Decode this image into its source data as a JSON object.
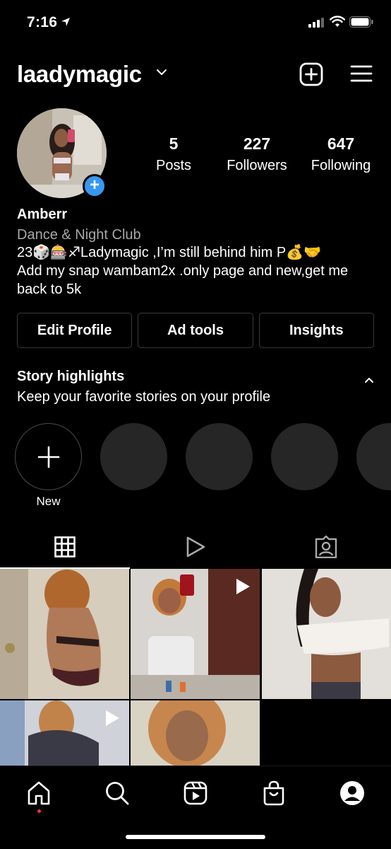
{
  "status_bar": {
    "time": "7:16"
  },
  "header": {
    "username": "laadymagic"
  },
  "profile": {
    "stats": [
      {
        "value": "5",
        "label": "Posts"
      },
      {
        "value": "227",
        "label": "Followers"
      },
      {
        "value": "647",
        "label": "Following"
      }
    ],
    "name": "Amberr",
    "category": "Dance & Night Club",
    "bio_lines": [
      "23🎲🎰♐Ladymagic ,I’m still behind him P💰🤝",
      "Add my snap wambam2x .only page and new,get me",
      "back to 5k"
    ]
  },
  "buttons": {
    "edit_profile": "Edit Profile",
    "ad_tools": "Ad tools",
    "insights": "Insights"
  },
  "highlights": {
    "title": "Story highlights",
    "subtitle": "Keep your favorite stories on your profile",
    "new_label": "New"
  },
  "tabs": {
    "active": "posts-grid",
    "icons": [
      "grid-icon",
      "reels-icon",
      "tagged-icon"
    ]
  },
  "grid": {
    "posts": [
      {
        "type": "photo"
      },
      {
        "type": "reel"
      },
      {
        "type": "photo"
      },
      {
        "type": "reel"
      },
      {
        "type": "photo"
      }
    ]
  },
  "bottom_nav": {
    "icons": [
      "home-icon",
      "search-icon",
      "reels-icon",
      "shop-icon",
      "profile-icon"
    ],
    "active": "home-icon"
  },
  "colors": {
    "accent": "#3897f0",
    "background": "#000000",
    "notification": "#ff3040"
  }
}
